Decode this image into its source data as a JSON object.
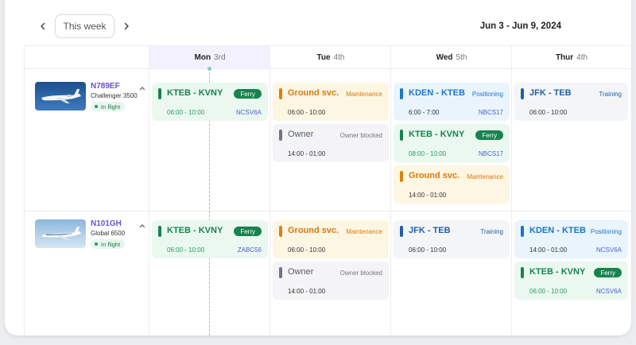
{
  "toolbar": {
    "prev_icon": "chevron-left-icon",
    "week_label": "This week",
    "next_icon": "chevron-right-icon",
    "date_range": "Jun 3 - Jun 9, 2024"
  },
  "days": [
    {
      "name": "Mon",
      "num": "3rd",
      "today": true
    },
    {
      "name": "Tue",
      "num": "4th"
    },
    {
      "name": "Wed",
      "num": "5th"
    },
    {
      "name": "Thur",
      "num": "4th"
    }
  ],
  "aircraft": [
    {
      "tail": "N789EF",
      "model": "Challenger 3500",
      "status": "In flight",
      "collapse_icon": "chevron-up-icon"
    },
    {
      "tail": "N101GH",
      "model": "Global 6500",
      "status": "In flight",
      "collapse_icon": "chevron-up-icon"
    }
  ],
  "cards": [
    {
      "kind": "ferry",
      "route": "KTEB - KVNY",
      "type": "Ferry",
      "time": "06:00 - 10:00",
      "ref": "NCSV6A"
    },
    {
      "kind": "maint",
      "route": "Ground svc.",
      "type": "Maintenance",
      "time": "06:00 - 10:00"
    },
    {
      "kind": "owner",
      "route": "Owner",
      "type": "Owner blocked",
      "time": "14:00 - 01:00"
    },
    {
      "kind": "pos",
      "route": "KDEN - KTEB",
      "type": "Positioning",
      "time": "6:00 - 7:00",
      "ref": "NBCS17"
    },
    {
      "kind": "ferry",
      "route": "KTEB - KVNY",
      "type": "Ferry",
      "time": "08:00 - 10:00",
      "ref": "NBCS17"
    },
    {
      "kind": "maint",
      "route": "Ground svc.",
      "type": "Maintenance",
      "time": "14:00 - 01:00"
    },
    {
      "kind": "train",
      "route": "JFK - TEB",
      "type": "Training",
      "time": "06:00 - 10:00"
    },
    {
      "kind": "ferry",
      "route": "KTEB - KVNY",
      "type": "Ferry",
      "time": "06:00 - 10:00",
      "ref": "ZABC56"
    },
    {
      "kind": "maint",
      "route": "Ground svc.",
      "type": "Maintenance",
      "time": "06:00 - 10:00"
    },
    {
      "kind": "owner",
      "route": "Owner",
      "type": "Owner blocked",
      "time": "14:00 - 01:00"
    },
    {
      "kind": "train",
      "route": "JFK - TEB",
      "type": "Training",
      "time": "06:00 - 10:00"
    },
    {
      "kind": "pos",
      "route": "KDEN - KTEB",
      "type": "Positioning",
      "time": "14:00 - 01:00",
      "ref": "NCSV6A"
    },
    {
      "kind": "ferry",
      "route": "KTEB - KVNY",
      "type": "Ferry",
      "time": "06:00 - 10:00",
      "ref": "NCSV6A"
    }
  ],
  "colors": {
    "ferry": "#17834d",
    "maintenance": "#df7f10",
    "owner": "#6c7486",
    "positioning": "#1977c9",
    "training": "#1e5fa8",
    "tail_text": "#6a4fd1",
    "today_header": "#f3f1fd",
    "now_line": "#7dd3b0"
  }
}
